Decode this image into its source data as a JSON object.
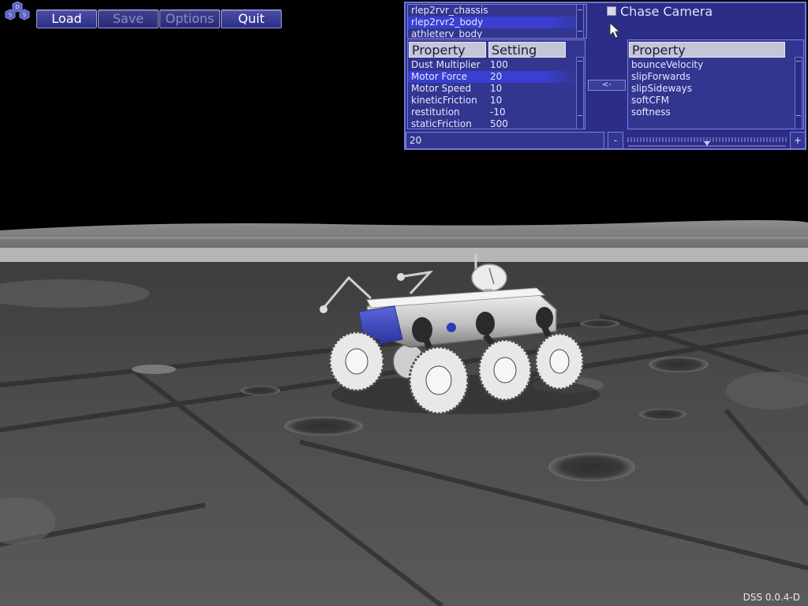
{
  "toolbar": {
    "logo_letters": [
      "D",
      "S",
      "S"
    ],
    "load_label": "Load",
    "save_label": "Save",
    "options_label": "Options",
    "quit_label": "Quit"
  },
  "object_list": {
    "items": [
      "rlep2rvr_chassis",
      "rlep2rvr2_body",
      "athleterv_body"
    ],
    "selected_index": 1
  },
  "chase_camera": {
    "label": "Chase Camera",
    "checked": false
  },
  "properties_table": {
    "header_property": "Property",
    "header_setting": "Setting",
    "rows": [
      {
        "property": "Dust Multiplier",
        "setting": "100"
      },
      {
        "property": "Motor Force",
        "setting": "20"
      },
      {
        "property": "Motor Speed",
        "setting": "10"
      },
      {
        "property": "kineticFriction",
        "setting": "10"
      },
      {
        "property": "restitution",
        "setting": "-10"
      },
      {
        "property": "staticFriction",
        "setting": "500"
      }
    ],
    "selected_index": 1
  },
  "move_button_label": "<-",
  "available_properties": {
    "header": "Property",
    "items": [
      "bounceVelocity",
      "slipForwards",
      "slipSideways",
      "softCFM",
      "softness"
    ]
  },
  "value_editor": {
    "value": "20",
    "minus_label": "-",
    "plus_label": "+",
    "slider_fraction": 0.5
  },
  "version": "DSS 0.0.4-D",
  "colors": {
    "panel_bg": "#2b2d86",
    "panel_border": "#6f74d6",
    "selection": "#3a3fd0",
    "rover_accent": "#3b46b8",
    "sky": "#000000"
  }
}
